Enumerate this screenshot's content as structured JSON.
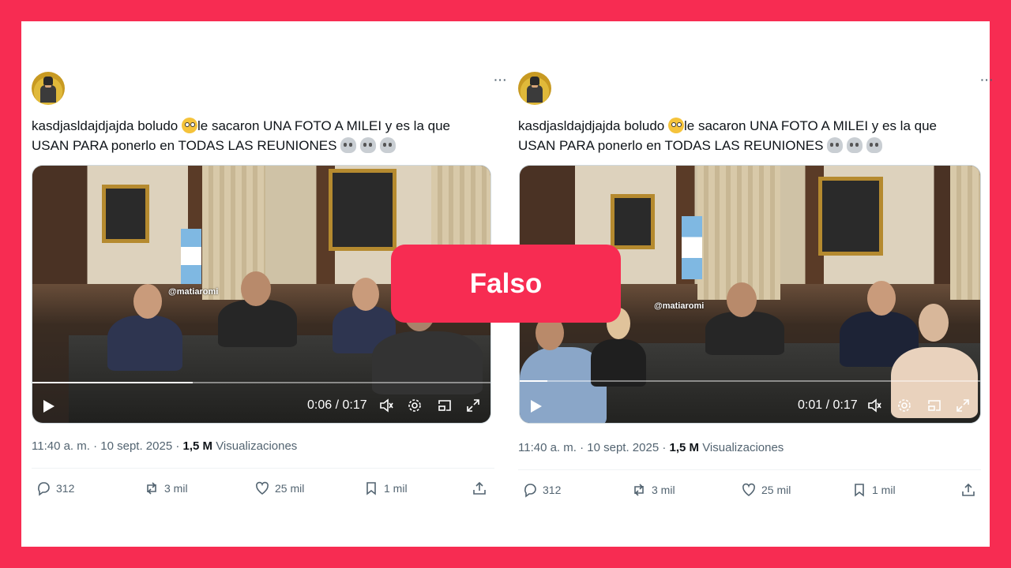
{
  "tweets": [
    {
      "side": "left",
      "more": "···",
      "text_line1": "kasdjasldajdjajda boludo",
      "text_line1b": "le sacaron UNA FOTO A MILEI y es la que",
      "text_line2": "USAN PARA ponerlo en TODAS LAS  REUNIONES",
      "watermark": "@matiaromi",
      "video_time": "0:06 / 0:17",
      "video_progress": 0.35,
      "timestamp": "11:40 a. m. · 10 sept. 2025 · ",
      "views_count": "1,5 M",
      "views_label": "Visualizaciones",
      "replies": "312",
      "reposts": "3 mil",
      "likes": "25 mil",
      "bookmarks": "1 mil"
    },
    {
      "side": "right",
      "more": "···",
      "text_line1": "kasdjasldajdjajda boludo",
      "text_line1b": "le sacaron UNA FOTO A MILEI y es la que",
      "text_line2": "USAN PARA ponerlo en TODAS LAS  REUNIONES",
      "watermark": "@matiaromi",
      "video_time": "0:01 / 0:17",
      "video_progress": 0.06,
      "timestamp": "11:40 a. m. · 10 sept. 2025 · ",
      "views_count": "1,5 M",
      "views_label": "Visualizaciones",
      "replies": "312",
      "reposts": "3 mil",
      "likes": "25 mil",
      "bookmarks": "1 mil"
    }
  ],
  "verdict": "Falso",
  "colors": {
    "background": "#f72c52",
    "panel": "#ffffff",
    "muted": "#536471",
    "text": "#0f1419"
  },
  "icons": [
    "more-icon",
    "flushed-face-emoji",
    "skull-emoji",
    "play-icon",
    "volume-icon",
    "settings-icon",
    "pip-icon",
    "fullscreen-icon",
    "reply-icon",
    "repost-icon",
    "like-icon",
    "bookmark-icon",
    "share-icon"
  ]
}
